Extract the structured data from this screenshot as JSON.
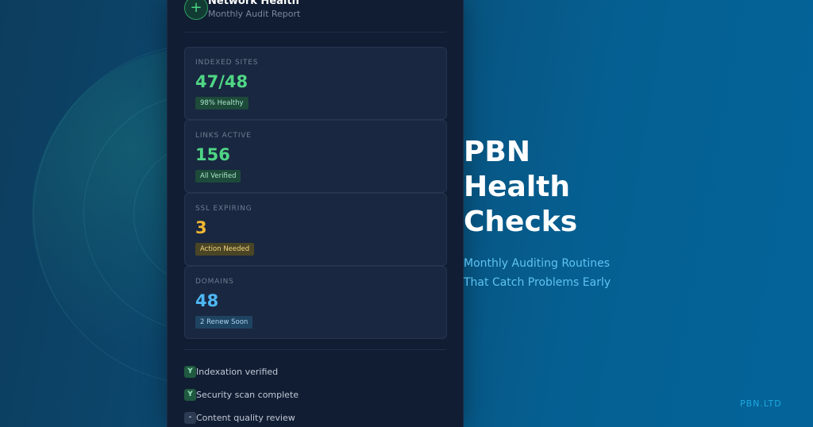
{
  "header": {
    "icon": "plus-icon",
    "icon_glyph": "+",
    "title": "Network Health",
    "subtitle": "Monthly Audit Report"
  },
  "cards": [
    {
      "label": "INDEXED SITES",
      "value": "47/48",
      "badge": "98% Healthy",
      "color": "#4fd685"
    },
    {
      "label": "LINKS ACTIVE",
      "value": "156",
      "badge": "All Verified",
      "color": "#4fd685"
    },
    {
      "label": "SSL EXPIRING",
      "value": "3",
      "badge": "Action Needed",
      "color": "#f2b731"
    },
    {
      "label": "DOMAINS",
      "value": "48",
      "badge": "2 Renew Soon",
      "color": "#4db7f2"
    }
  ],
  "checklist": [
    {
      "mark": "Y",
      "text": "Indexation verified",
      "status": "done"
    },
    {
      "mark": "Y",
      "text": "Security scan complete",
      "status": "done"
    },
    {
      "mark": "-",
      "text": "Content quality review",
      "status": "pending"
    }
  ],
  "hero": {
    "title_lines": [
      "PBN",
      "Health",
      "Checks"
    ],
    "subtitle_lines": [
      "Monthly Auditing Routines",
      "That Catch Problems Early"
    ]
  },
  "brand": "PBN.LTD"
}
